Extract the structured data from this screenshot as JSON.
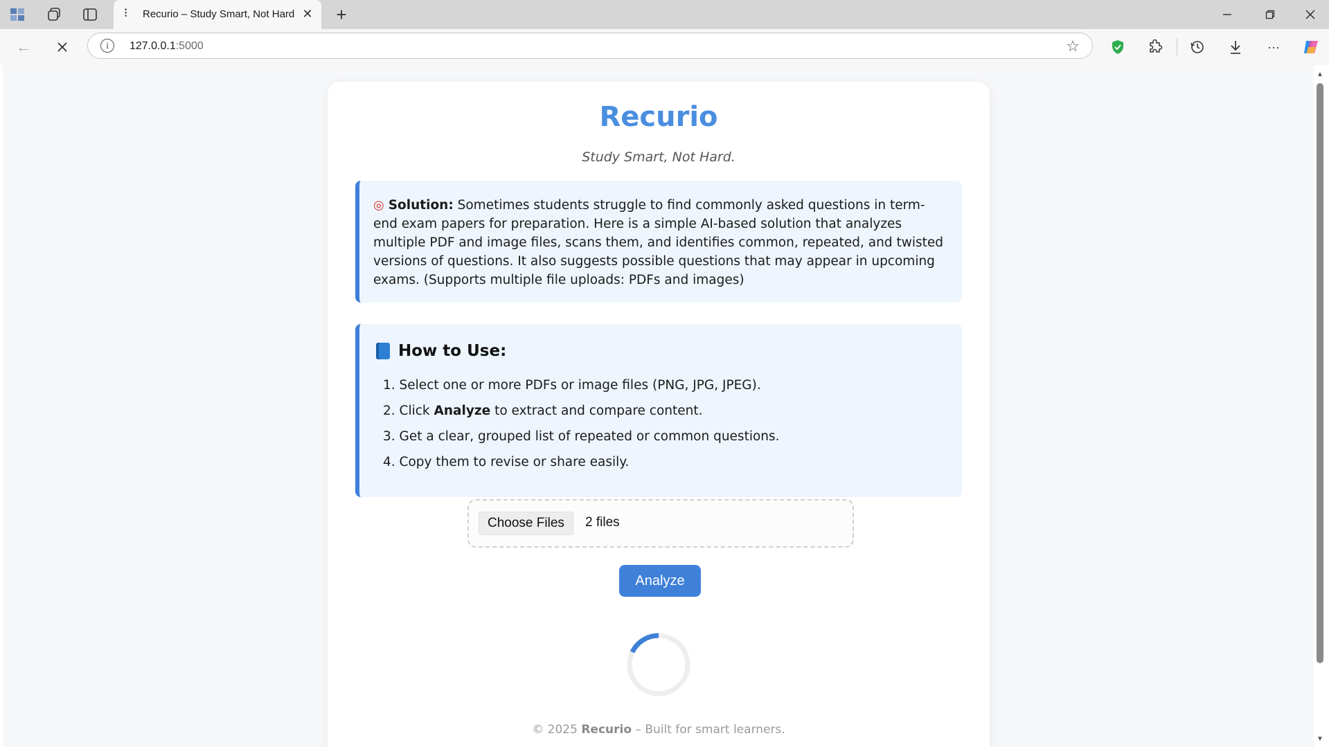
{
  "browser": {
    "tab_title": "Recurio – Study Smart, Not Hard",
    "url_host": "127.0.0.1",
    "url_port": ":5000",
    "icons": [
      "app-menu-icon",
      "workspaces-icon",
      "tab-actions-icon",
      "back-icon",
      "stop-icon",
      "site-info-icon",
      "favorite-star-icon",
      "shield-icon",
      "extensions-icon",
      "history-icon",
      "downloads-icon",
      "more-icon",
      "copilot-icon"
    ]
  },
  "page": {
    "title": "Recurio",
    "tagline": "Study Smart, Not Hard.",
    "solution": {
      "label": "Solution:",
      "text": "Sometimes students struggle to find commonly asked questions in term-end exam papers for preparation. Here is a simple AI-based solution that analyzes multiple PDF and image files, scans them, and identifies common, repeated, and twisted versions of questions. It also suggests possible questions that may appear in upcoming exams. (Supports multiple file uploads: PDFs and images)"
    },
    "howto": {
      "heading": "How to Use:",
      "steps": [
        {
          "num": "1.",
          "pre": "Select one or more PDFs or image files (PNG, JPG, JPEG).",
          "bold": "",
          "post": ""
        },
        {
          "num": "2.",
          "pre": "Click ",
          "bold": "Analyze",
          "post": " to extract and compare content."
        },
        {
          "num": "3.",
          "pre": "Get a clear, grouped list of repeated or common questions.",
          "bold": "",
          "post": ""
        },
        {
          "num": "4.",
          "pre": "Copy them to revise or share easily.",
          "bold": "",
          "post": ""
        }
      ]
    },
    "upload": {
      "button_label": "Choose Files",
      "file_count": "2 files"
    },
    "analyze_label": "Analyze",
    "footer": {
      "prefix": "© 2025 ",
      "brand": "Recurio",
      "suffix": " – Built for smart learners."
    }
  },
  "colors": {
    "accent": "#3f80d8",
    "title": "#4a8ee0",
    "info_bg": "#eef5fd"
  }
}
